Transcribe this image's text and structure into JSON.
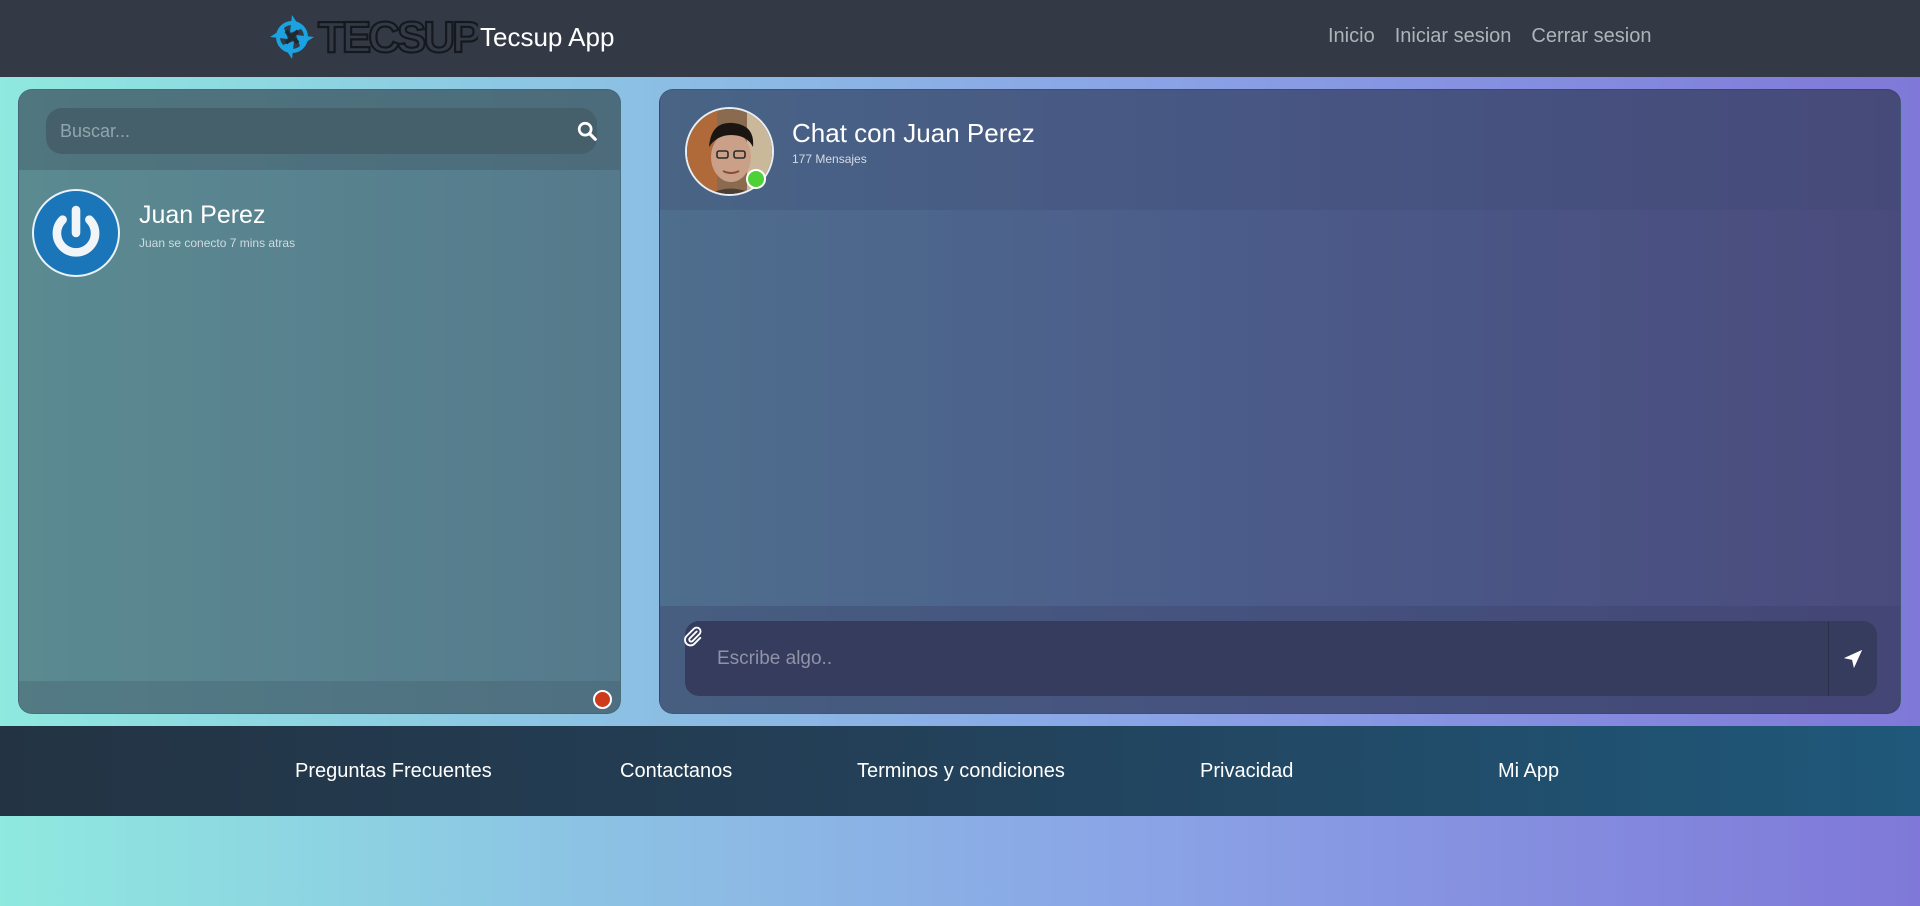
{
  "navbar": {
    "brand_name": "Tecsup App",
    "links": [
      "Inicio",
      "Iniciar sesion",
      "Cerrar sesion"
    ]
  },
  "sidebar": {
    "search_placeholder": "Buscar...",
    "contacts": [
      {
        "name": "Juan Perez",
        "status": "Juan se conecto 7 mins atras"
      }
    ]
  },
  "chat": {
    "title": "Chat con Juan Perez",
    "message_count": "177 Mensajes",
    "input_placeholder": "Escribe algo.."
  },
  "footer": {
    "links": [
      "Preguntas Frecuentes",
      "Contactanos",
      "Terminos y condiciones",
      "Privacidad",
      "Mi App"
    ]
  },
  "icons": {
    "search": "search-icon",
    "attach": "paperclip-icon",
    "send": "send-icon",
    "logo": "tecsup-logo",
    "contact_avatar": "power-icon"
  },
  "colors": {
    "navbar_bg": "#343a45",
    "online": "#4cd137",
    "offline": "#cf3a1a",
    "avatar_blue": "#1a76b9"
  }
}
